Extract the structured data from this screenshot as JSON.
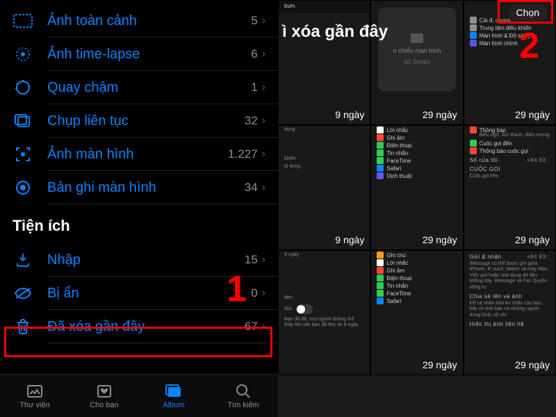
{
  "left": {
    "rows": [
      {
        "icon": "pano",
        "label": "Ảnh toàn cảnh",
        "count": "5"
      },
      {
        "icon": "timelapse",
        "label": "Ảnh time-lapse",
        "count": "6"
      },
      {
        "icon": "slomo",
        "label": "Quay chậm",
        "count": "1"
      },
      {
        "icon": "burst",
        "label": "Chụp liên tục",
        "count": "32"
      },
      {
        "icon": "screenshot",
        "label": "Ảnh màn hình",
        "count": "1.227"
      },
      {
        "icon": "screenrec",
        "label": "Bản ghi màn hình",
        "count": "34"
      }
    ],
    "section_title": "Tiện ích",
    "util_rows": [
      {
        "icon": "import",
        "label": "Nhập",
        "count": "15"
      },
      {
        "icon": "hidden",
        "label": "Bị ẩn",
        "count": "0"
      },
      {
        "icon": "trash",
        "label": "Đã xóa gần đây",
        "count": "67"
      }
    ],
    "tabs": [
      {
        "icon": "library",
        "label": "Thư viện"
      },
      {
        "icon": "foryou",
        "label": "Cho bạn"
      },
      {
        "icon": "albums",
        "label": "Album"
      },
      {
        "icon": "search",
        "label": "Tìm kiếm"
      }
    ]
  },
  "right": {
    "title": "ì xóa gần đây",
    "select_label": "Chọn",
    "days_label": "29 ngày",
    "album_text": "bum",
    "thumbs": {
      "t2_card": "n chiếu màn hình",
      "t2_sub": "60 Series",
      "t3_rows": [
        {
          "c": "#8e8e93",
          "t": "Cài đ. chung"
        },
        {
          "c": "#8e8e93",
          "t": "Trung tâm điều khiển"
        },
        {
          "c": "#0a84ff",
          "t": "Màn hình & Độ sáng"
        },
        {
          "c": "#5856d6",
          "t": "Màn hình chính"
        }
      ],
      "t4_texts": [
        "9 ngày",
        "dụng",
        "khiển",
        "ội dung",
        "9 ngày"
      ],
      "t5_rows": [
        {
          "c": "#ffffff",
          "t": "Lời nhắc"
        },
        {
          "c": "#ff453a",
          "t": "Ghi âm"
        },
        {
          "c": "#34c759",
          "t": "Điện thoại"
        },
        {
          "c": "#34c759",
          "t": "Tin nhắn"
        },
        {
          "c": "#30d158",
          "t": "FaceTime"
        },
        {
          "c": "#0a84ff",
          "t": "Safari"
        },
        {
          "c": "#5e5ce6",
          "t": "Dịch thuật"
        }
      ],
      "t6_rows": [
        {
          "c": "#ff453a",
          "t": "Thông báo",
          "s": "Biểu ngữ, Âm thanh, Biểu tượng"
        },
        {
          "c": "#34c759",
          "t": "Cuộc gọi đến"
        },
        {
          "c": "#ff453a",
          "t": "Thông báo cuộc gọi"
        }
      ],
      "t6_group2_head": "Số của tôi",
      "t6_group2_val": "+84 83 :",
      "t6_group3_head": "CUỘC GỌI",
      "t6_group3_row": "Cuộc gọi trên",
      "t8_rows": [
        {
          "c": "#ff9f0a",
          "t": "Ghi chú"
        },
        {
          "c": "#ffffff",
          "t": "Lời nhắc"
        },
        {
          "c": "#ff453a",
          "t": "Ghi âm"
        },
        {
          "c": "#34c759",
          "t": "Điện thoại"
        },
        {
          "c": "#34c759",
          "t": "Tin nhắn"
        },
        {
          "c": "#30d158",
          "t": "FaceTime"
        },
        {
          "c": "#0a84ff",
          "t": "Safari"
        }
      ],
      "t9_head1": "Gửi & nhận",
      "t9_head1_val": "+84 83 :",
      "t9_body": "iMessage có thể được gửi giữa iPhone, iF ouch, Watch và máy Mac. Việc gửi hoặc nhé dụng dữ liệu không dây. iMessage và Fac Quyền riêng tư",
      "t9_head2": "Chia sẻ tên và ảnh",
      "t9_body2": "Để cá nhân hóa tin nhắn của bạn, hãy ch ảnh bạn và những người dùng khác sẽ nhì",
      "t9_head3": "Hiển thị ảnh liên hệ",
      "t7_texts": [
        "9 ngày",
        "đèn",
        "đọc",
        "Bạn đã tắt, mọi người không thể thấy khi nào bạn đã đọc tin 9 ngày"
      ]
    }
  },
  "callouts": {
    "one": "1",
    "two": "2"
  }
}
